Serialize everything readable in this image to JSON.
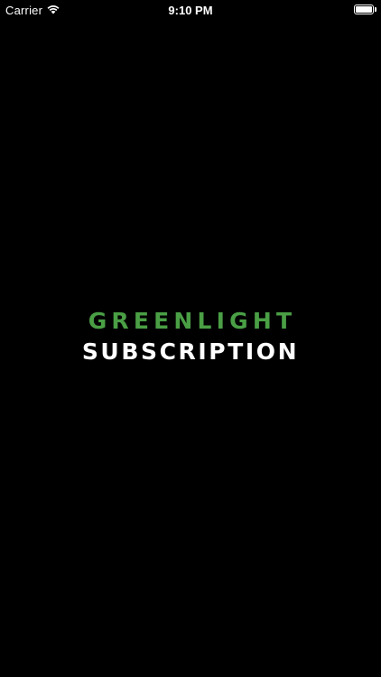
{
  "status_bar": {
    "carrier": "Carrier",
    "time": "9:10 PM",
    "wifi_icon": "wifi-icon",
    "battery_icon": "battery-icon",
    "battery_level": 1.0
  },
  "logo": {
    "line1": "GREENLIGHT",
    "line2": "SUBSCRIPTION",
    "line1_color": "#4a9f45",
    "line2_color": "#ffffff"
  },
  "background_color": "#000000"
}
